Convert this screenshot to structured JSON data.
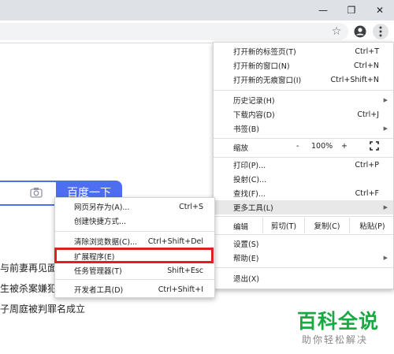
{
  "window": {
    "minimize_glyph": "—",
    "restore_glyph": "❐",
    "close_glyph": "✕"
  },
  "toolbar": {
    "bookmark_star_icon": "star-icon",
    "profile_icon": "account-icon",
    "menu_icon": "three-dot-icon"
  },
  "page": {
    "search_button": "百度一下",
    "camera_icon": "camera-icon",
    "hot_items": [
      "与前妻再见面",
      "生被杀案嫌犯",
      "子周庭被判罪名成立"
    ]
  },
  "menu": {
    "new_tab": {
      "label": "打开新的标签页(T)",
      "shortcut": "Ctrl+T"
    },
    "new_window": {
      "label": "打开新的窗口(N)",
      "shortcut": "Ctrl+N"
    },
    "incognito": {
      "label": "打开新的无痕窗口(I)",
      "shortcut": "Ctrl+Shift+N"
    },
    "history": {
      "label": "历史记录(H)"
    },
    "downloads": {
      "label": "下载内容(D)",
      "shortcut": "Ctrl+J"
    },
    "bookmarks": {
      "label": "书签(B)"
    },
    "zoom": {
      "label": "缩放",
      "minus": "-",
      "value": "100%",
      "plus": "+"
    },
    "print": {
      "label": "打印(P)...",
      "shortcut": "Ctrl+P"
    },
    "cast": {
      "label": "投射(C)..."
    },
    "find": {
      "label": "查找(F)...",
      "shortcut": "Ctrl+F"
    },
    "more_tools": {
      "label": "更多工具(L)"
    },
    "edit": {
      "label": "编辑",
      "cut": "剪切(T)",
      "copy": "复制(C)",
      "paste": "粘贴(P)"
    },
    "settings": {
      "label": "设置(S)"
    },
    "help": {
      "label": "帮助(E)"
    },
    "exit": {
      "label": "退出(X)"
    }
  },
  "submenu": {
    "save_page": {
      "label": "网页另存为(A)...",
      "shortcut": "Ctrl+S"
    },
    "create_shortcut": {
      "label": "创建快捷方式..."
    },
    "clear_data": {
      "label": "清除浏览数据(C)...",
      "shortcut": "Ctrl+Shift+Del"
    },
    "extensions": {
      "label": "扩展程序(E)"
    },
    "task_manager": {
      "label": "任务管理器(T)",
      "shortcut": "Shift+Esc"
    },
    "devtools": {
      "label": "开发者工具(D)",
      "shortcut": "Ctrl+Shift+I"
    }
  },
  "watermark": {
    "title": "百科全说",
    "subtitle": "助你轻松解决"
  },
  "colors": {
    "highlight_box": "#e02020",
    "search_blue": "#4e6ef2",
    "watermark_green": "#1aa844"
  }
}
